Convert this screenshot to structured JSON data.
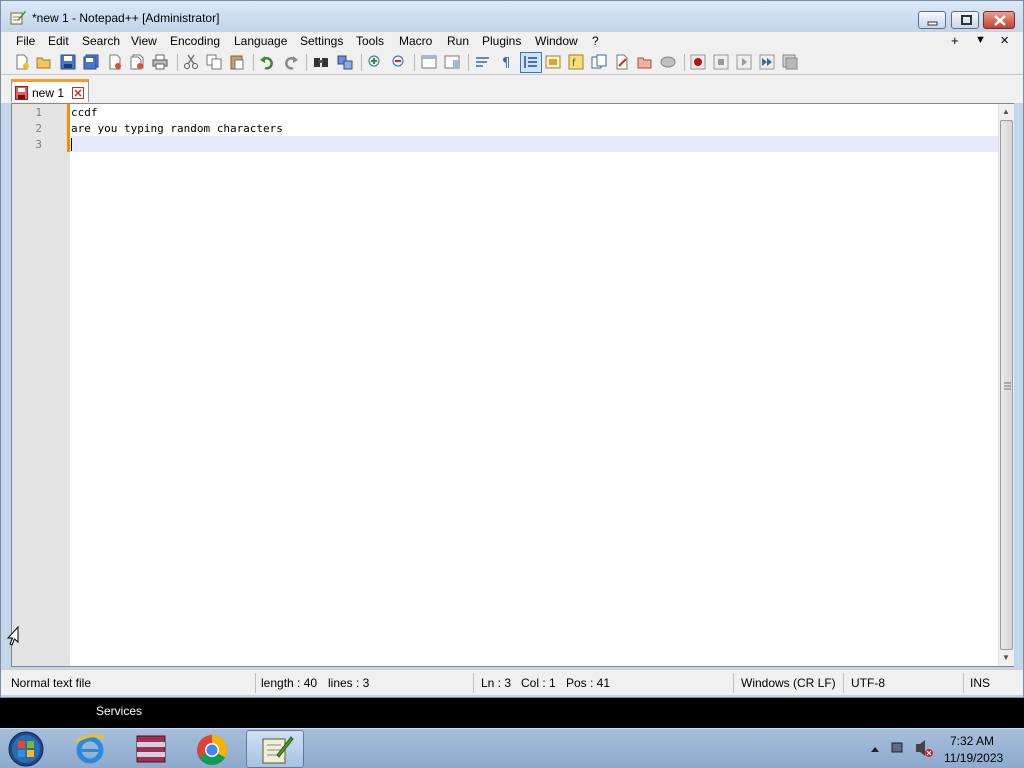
{
  "window": {
    "title": "*new 1 - Notepad++ [Administrator]"
  },
  "menu": {
    "items": [
      "File",
      "Edit",
      "Search",
      "View",
      "Encoding",
      "Language",
      "Settings",
      "Tools",
      "Macro",
      "Run",
      "Plugins",
      "Window",
      "?"
    ],
    "right": [
      "+",
      "▼",
      "✕"
    ]
  },
  "toolbar": {
    "icons": [
      "new-file-icon",
      "open-file-icon",
      "save-icon",
      "save-all-icon",
      "close-icon",
      "close-all-icon",
      "print-icon",
      "cut-icon",
      "copy-icon",
      "paste-icon",
      "undo-icon",
      "redo-icon",
      "find-icon",
      "replace-icon",
      "zoom-in-icon",
      "zoom-out-icon",
      "sync-vertical-icon",
      "sync-horizontal-icon",
      "word-wrap-icon",
      "show-all-characters-icon",
      "indent-guide-icon",
      "doc-map-icon",
      "function-list-icon",
      "folder-workspace-icon",
      "monitoring-icon",
      "doc-switcher-icon",
      "record-macro-icon",
      "stop-macro-icon",
      "play-macro-icon",
      "run-macro-multiple-icon",
      "save-macro-icon"
    ],
    "active": "indent-guide-icon"
  },
  "tabs": [
    {
      "label": "new 1",
      "modified": true
    }
  ],
  "editor": {
    "lines": [
      "ccdf",
      "are you typing random characters",
      ""
    ],
    "line_numbers": [
      "1",
      "2",
      "3"
    ],
    "current_line": 3
  },
  "status": {
    "file_type": "Normal text file",
    "length": "length : 40",
    "lines": "lines : 3",
    "ln": "Ln : 3",
    "col": "Col : 1",
    "pos": "Pos : 41",
    "eol": "Windows (CR LF)",
    "encoding": "UTF-8",
    "mode": "INS"
  },
  "services_label": "Services",
  "taskbar": {
    "items": [
      "internet-explorer-icon",
      "archive-manager-icon",
      "chrome-icon",
      "notepad-plus-plus-icon"
    ],
    "active": "notepad-plus-plus-icon",
    "clock_time": "7:32 AM",
    "clock_date": "11/19/2023"
  }
}
